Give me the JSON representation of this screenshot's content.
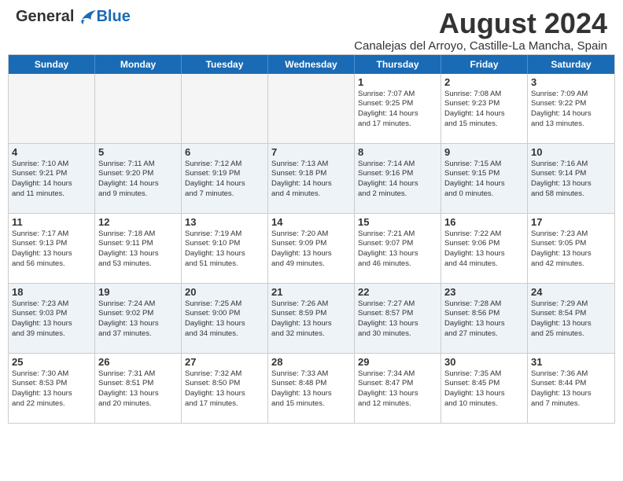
{
  "header": {
    "logo": {
      "general": "General",
      "blue": "Blue"
    },
    "title": "August 2024",
    "location": "Canalejas del Arroyo, Castille-La Mancha, Spain"
  },
  "calendar": {
    "days": [
      "Sunday",
      "Monday",
      "Tuesday",
      "Wednesday",
      "Thursday",
      "Friday",
      "Saturday"
    ],
    "rows": [
      [
        {
          "day": "",
          "lines": []
        },
        {
          "day": "",
          "lines": []
        },
        {
          "day": "",
          "lines": []
        },
        {
          "day": "",
          "lines": []
        },
        {
          "day": "1",
          "lines": [
            "Sunrise: 7:07 AM",
            "Sunset: 9:25 PM",
            "Daylight: 14 hours",
            "and 17 minutes."
          ]
        },
        {
          "day": "2",
          "lines": [
            "Sunrise: 7:08 AM",
            "Sunset: 9:23 PM",
            "Daylight: 14 hours",
            "and 15 minutes."
          ]
        },
        {
          "day": "3",
          "lines": [
            "Sunrise: 7:09 AM",
            "Sunset: 9:22 PM",
            "Daylight: 14 hours",
            "and 13 minutes."
          ]
        }
      ],
      [
        {
          "day": "4",
          "lines": [
            "Sunrise: 7:10 AM",
            "Sunset: 9:21 PM",
            "Daylight: 14 hours",
            "and 11 minutes."
          ]
        },
        {
          "day": "5",
          "lines": [
            "Sunrise: 7:11 AM",
            "Sunset: 9:20 PM",
            "Daylight: 14 hours",
            "and 9 minutes."
          ]
        },
        {
          "day": "6",
          "lines": [
            "Sunrise: 7:12 AM",
            "Sunset: 9:19 PM",
            "Daylight: 14 hours",
            "and 7 minutes."
          ]
        },
        {
          "day": "7",
          "lines": [
            "Sunrise: 7:13 AM",
            "Sunset: 9:18 PM",
            "Daylight: 14 hours",
            "and 4 minutes."
          ]
        },
        {
          "day": "8",
          "lines": [
            "Sunrise: 7:14 AM",
            "Sunset: 9:16 PM",
            "Daylight: 14 hours",
            "and 2 minutes."
          ]
        },
        {
          "day": "9",
          "lines": [
            "Sunrise: 7:15 AM",
            "Sunset: 9:15 PM",
            "Daylight: 14 hours",
            "and 0 minutes."
          ]
        },
        {
          "day": "10",
          "lines": [
            "Sunrise: 7:16 AM",
            "Sunset: 9:14 PM",
            "Daylight: 13 hours",
            "and 58 minutes."
          ]
        }
      ],
      [
        {
          "day": "11",
          "lines": [
            "Sunrise: 7:17 AM",
            "Sunset: 9:13 PM",
            "Daylight: 13 hours",
            "and 56 minutes."
          ]
        },
        {
          "day": "12",
          "lines": [
            "Sunrise: 7:18 AM",
            "Sunset: 9:11 PM",
            "Daylight: 13 hours",
            "and 53 minutes."
          ]
        },
        {
          "day": "13",
          "lines": [
            "Sunrise: 7:19 AM",
            "Sunset: 9:10 PM",
            "Daylight: 13 hours",
            "and 51 minutes."
          ]
        },
        {
          "day": "14",
          "lines": [
            "Sunrise: 7:20 AM",
            "Sunset: 9:09 PM",
            "Daylight: 13 hours",
            "and 49 minutes."
          ]
        },
        {
          "day": "15",
          "lines": [
            "Sunrise: 7:21 AM",
            "Sunset: 9:07 PM",
            "Daylight: 13 hours",
            "and 46 minutes."
          ]
        },
        {
          "day": "16",
          "lines": [
            "Sunrise: 7:22 AM",
            "Sunset: 9:06 PM",
            "Daylight: 13 hours",
            "and 44 minutes."
          ]
        },
        {
          "day": "17",
          "lines": [
            "Sunrise: 7:23 AM",
            "Sunset: 9:05 PM",
            "Daylight: 13 hours",
            "and 42 minutes."
          ]
        }
      ],
      [
        {
          "day": "18",
          "lines": [
            "Sunrise: 7:23 AM",
            "Sunset: 9:03 PM",
            "Daylight: 13 hours",
            "and 39 minutes."
          ]
        },
        {
          "day": "19",
          "lines": [
            "Sunrise: 7:24 AM",
            "Sunset: 9:02 PM",
            "Daylight: 13 hours",
            "and 37 minutes."
          ]
        },
        {
          "day": "20",
          "lines": [
            "Sunrise: 7:25 AM",
            "Sunset: 9:00 PM",
            "Daylight: 13 hours",
            "and 34 minutes."
          ]
        },
        {
          "day": "21",
          "lines": [
            "Sunrise: 7:26 AM",
            "Sunset: 8:59 PM",
            "Daylight: 13 hours",
            "and 32 minutes."
          ]
        },
        {
          "day": "22",
          "lines": [
            "Sunrise: 7:27 AM",
            "Sunset: 8:57 PM",
            "Daylight: 13 hours",
            "and 30 minutes."
          ]
        },
        {
          "day": "23",
          "lines": [
            "Sunrise: 7:28 AM",
            "Sunset: 8:56 PM",
            "Daylight: 13 hours",
            "and 27 minutes."
          ]
        },
        {
          "day": "24",
          "lines": [
            "Sunrise: 7:29 AM",
            "Sunset: 8:54 PM",
            "Daylight: 13 hours",
            "and 25 minutes."
          ]
        }
      ],
      [
        {
          "day": "25",
          "lines": [
            "Sunrise: 7:30 AM",
            "Sunset: 8:53 PM",
            "Daylight: 13 hours",
            "and 22 minutes."
          ]
        },
        {
          "day": "26",
          "lines": [
            "Sunrise: 7:31 AM",
            "Sunset: 8:51 PM",
            "Daylight: 13 hours",
            "and 20 minutes."
          ]
        },
        {
          "day": "27",
          "lines": [
            "Sunrise: 7:32 AM",
            "Sunset: 8:50 PM",
            "Daylight: 13 hours",
            "and 17 minutes."
          ]
        },
        {
          "day": "28",
          "lines": [
            "Sunrise: 7:33 AM",
            "Sunset: 8:48 PM",
            "Daylight: 13 hours",
            "and 15 minutes."
          ]
        },
        {
          "day": "29",
          "lines": [
            "Sunrise: 7:34 AM",
            "Sunset: 8:47 PM",
            "Daylight: 13 hours",
            "and 12 minutes."
          ]
        },
        {
          "day": "30",
          "lines": [
            "Sunrise: 7:35 AM",
            "Sunset: 8:45 PM",
            "Daylight: 13 hours",
            "and 10 minutes."
          ]
        },
        {
          "day": "31",
          "lines": [
            "Sunrise: 7:36 AM",
            "Sunset: 8:44 PM",
            "Daylight: 13 hours",
            "and 7 minutes."
          ]
        }
      ]
    ]
  }
}
